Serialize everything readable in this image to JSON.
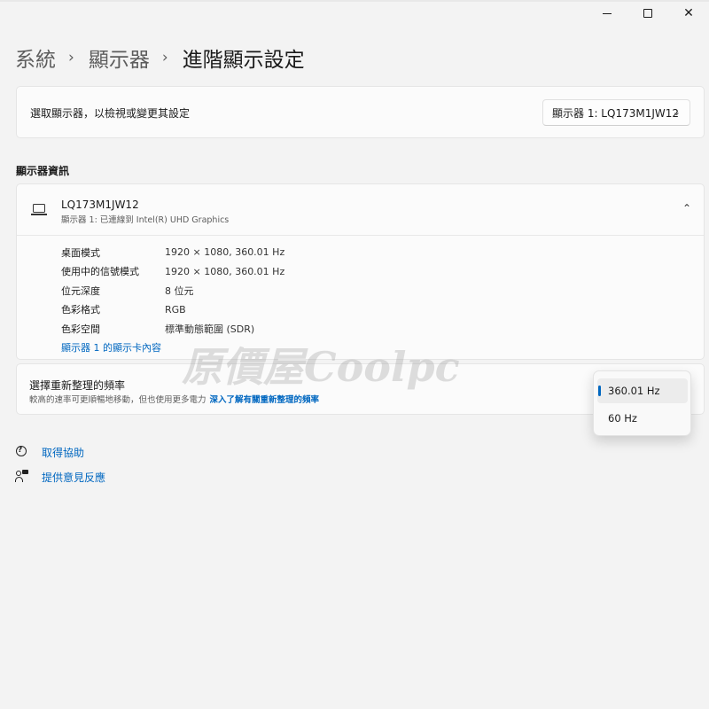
{
  "window": {
    "minimize": "—",
    "maximize": "☐",
    "close": "✕"
  },
  "breadcrumb": {
    "items": [
      "系統",
      "顯示器",
      "進階顯示設定"
    ],
    "separator": "›"
  },
  "select_display": {
    "label": "選取顯示器，以檢視或變更其設定",
    "selected": "顯示器 1: LQ173M1JW12"
  },
  "display_info": {
    "section_title": "顯示器資訊",
    "monitor_name": "LQ173M1JW12",
    "monitor_subtitle": "顯示器 1: 已連線到 Intel(R) UHD Graphics",
    "rows": [
      {
        "label": "桌面模式",
        "value": "1920 × 1080, 360.01 Hz"
      },
      {
        "label": "使用中的信號模式",
        "value": "1920 × 1080, 360.01 Hz"
      },
      {
        "label": "位元深度",
        "value": "8 位元"
      },
      {
        "label": "色彩格式",
        "value": "RGB"
      },
      {
        "label": "色彩空間",
        "value": "標準動態範圍 (SDR)"
      }
    ],
    "adapter_link": "顯示器 1 的顯示卡內容"
  },
  "refresh_rate": {
    "title": "選擇重新整理的頻率",
    "description": "較高的速率可更順暢地移動，但也使用更多電力",
    "learn_more": "深入了解有關重新整理的頻率",
    "options": [
      "360.01 Hz",
      "60 Hz"
    ],
    "selected": "360.01 Hz"
  },
  "footer_links": {
    "help": "取得協助",
    "feedback": "提供意見反應"
  },
  "watermark": "原價屋Coolpc",
  "colors": {
    "accent": "#0067c0",
    "background": "#f3f3f3",
    "card": "#fbfbfb"
  },
  "icons": {
    "laptop": "laptop-icon",
    "help": "help-icon",
    "feedback": "feedback-icon",
    "chevron_down": "chevron-down-icon",
    "chevron_up": "chevron-up-icon"
  }
}
